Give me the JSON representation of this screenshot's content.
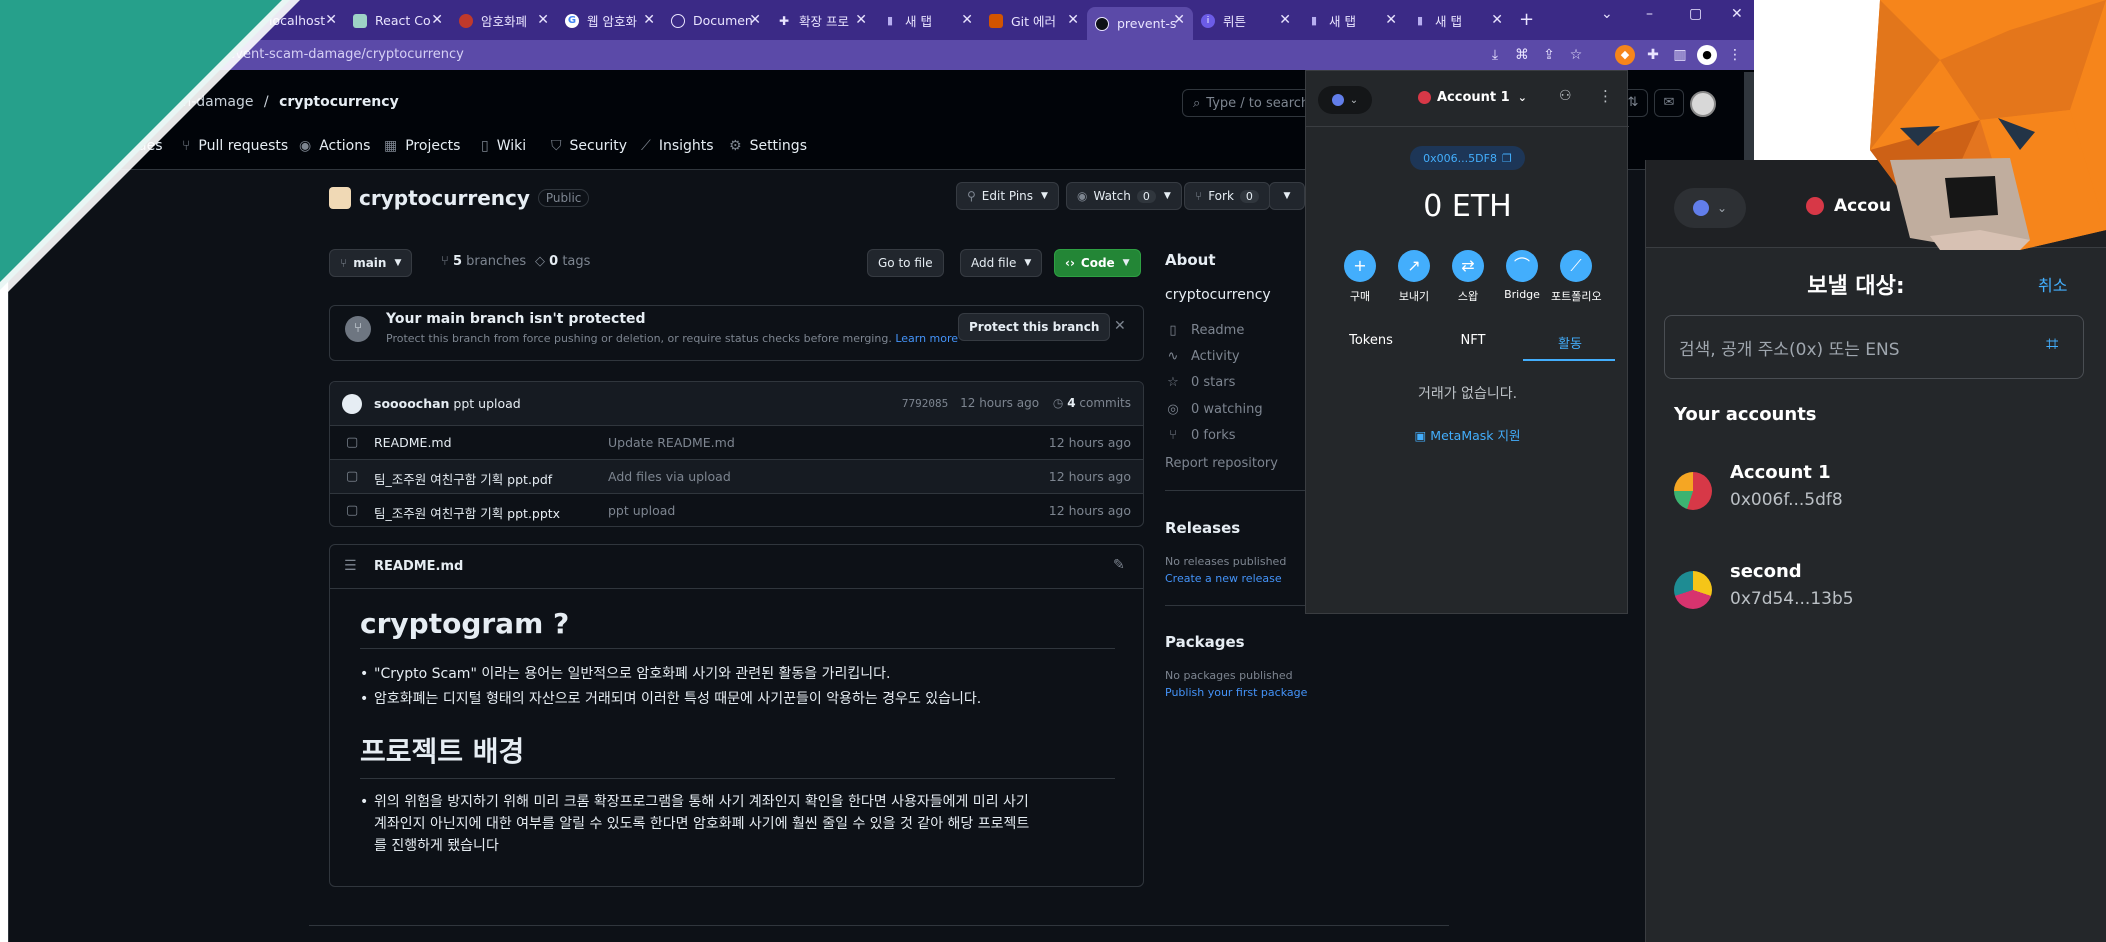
{
  "browser": {
    "tabs": [
      {
        "label": "localhost",
        "icon": "globe-icon",
        "active": false
      },
      {
        "label": "React Co",
        "icon": "react-icon",
        "active": false
      },
      {
        "label": "암호화폐",
        "icon": "coin-icon",
        "active": false
      },
      {
        "label": "웹 암호화",
        "icon": "google-icon",
        "active": false
      },
      {
        "label": "Documen",
        "icon": "globe-icon",
        "active": false
      },
      {
        "label": "확장 프로",
        "icon": "puzzle-icon",
        "active": false
      },
      {
        "label": "새 탭",
        "icon": "bookmark-icon",
        "active": false
      },
      {
        "label": "Git 에러",
        "icon": "velog-icon",
        "active": false
      },
      {
        "label": "prevent-s",
        "icon": "github-icon",
        "active": true
      },
      {
        "label": "뤼튼",
        "icon": "wrtn-icon",
        "active": false
      },
      {
        "label": "새 탭",
        "icon": "bookmark-icon",
        "active": false
      },
      {
        "label": "새 탭",
        "icon": "bookmark-icon",
        "active": false
      }
    ],
    "new_tab": "+",
    "url": "prevent-scam-damage/cryptocurrency"
  },
  "github": {
    "breadcrumb": {
      "owner": "scam-damage",
      "sep": "/",
      "repo": "cryptocurrency"
    },
    "search_placeholder": "Type / to search",
    "nav": [
      {
        "label": "Issues",
        "icon": "issue-icon"
      },
      {
        "label": "Pull requests",
        "icon": "pull-request-icon"
      },
      {
        "label": "Actions",
        "icon": "play-icon"
      },
      {
        "label": "Projects",
        "icon": "table-icon"
      },
      {
        "label": "Wiki",
        "icon": "book-icon"
      },
      {
        "label": "Security",
        "icon": "shield-icon"
      },
      {
        "label": "Insights",
        "icon": "graph-icon"
      },
      {
        "label": "Settings",
        "icon": "gear-icon"
      }
    ],
    "repo": {
      "title": "cryptocurrency",
      "visibility": "Public"
    },
    "buttons": {
      "edit_pins": "Edit Pins",
      "watch": "Watch",
      "watch_count": "0",
      "fork": "Fork",
      "fork_count": "0",
      "branch": "main",
      "go_to_file": "Go to file",
      "add_file": "Add file",
      "code": "Code"
    },
    "branches": {
      "count": "5",
      "label": "branches"
    },
    "tags": {
      "count": "0",
      "label": "tags"
    },
    "protect": {
      "title": "Your main branch isn't protected",
      "desc": "Protect this branch from force pushing or deletion, or require status checks before merging.",
      "learn_more": "Learn more",
      "button": "Protect this branch"
    },
    "commit": {
      "author": "soooochan",
      "message": "ppt upload",
      "hash": "7792085",
      "time": "12 hours ago",
      "count": "4",
      "count_label": "commits"
    },
    "files": [
      {
        "name": "README.md",
        "message": "Update README.md",
        "time": "12 hours ago"
      },
      {
        "name": "팀_조주원 여친구함 기획 ppt.pdf",
        "message": "Add files via upload",
        "time": "12 hours ago"
      },
      {
        "name": "팀_조주원 여친구함 기획 ppt.pptx",
        "message": "ppt upload",
        "time": "12 hours ago"
      }
    ],
    "readme": {
      "filename": "README.md",
      "h1": "cryptogram ?",
      "bullets1": [
        "\"Crypto Scam\" 이라는 용어는 일반적으로 암호화폐 사기와 관련된 활동을 가리킵니다.",
        "암호화폐는 디지털 형태의 자산으로 거래되며 이러한 특성 때문에 사기꾼들이 악용하는 경우도 있습니다."
      ],
      "h2": "프로젝트 배경",
      "bullet2_lines": [
        "위의 위험을 방지하기 위해 미리 크롬 확장프로그램을 통해 사기 계좌인지 확인을 한다면 사용자들에게 미리 사기",
        "계좌인지 아닌지에 대한 여부를 알릴 수 있도록 한다면 암호화폐 사기에 훨씬 줄일 수 있을 것 같아 해당 프로젝트",
        "를 진행하게 됐습니다"
      ]
    },
    "about": {
      "title": "About",
      "desc": "cryptocurrency",
      "items": [
        {
          "label": "Readme",
          "icon": "book-icon"
        },
        {
          "label": "Activity",
          "icon": "pulse-icon"
        },
        {
          "label": "0 stars",
          "icon": "star-icon"
        },
        {
          "label": "0 watching",
          "icon": "eye-icon"
        },
        {
          "label": "0 forks",
          "icon": "fork-icon"
        }
      ],
      "report": "Report repository"
    },
    "releases": {
      "title": "Releases",
      "empty": "No releases published",
      "link": "Create a new release"
    },
    "packages": {
      "title": "Packages",
      "empty": "No packages published",
      "link": "Publish your first package"
    }
  },
  "metamask_popup": {
    "account": "Account 1",
    "address": "0x006...5DF8",
    "balance": "0 ETH",
    "actions": [
      {
        "label": "구매",
        "icon": "plus-icon"
      },
      {
        "label": "보내기",
        "icon": "send-arrow-icon"
      },
      {
        "label": "스왑",
        "icon": "swap-icon"
      },
      {
        "label": "Bridge",
        "icon": "bridge-icon"
      },
      {
        "label": "포트폴리오",
        "icon": "chart-icon"
      }
    ],
    "tabs": [
      {
        "label": "Tokens",
        "active": false
      },
      {
        "label": "NFT",
        "active": false
      },
      {
        "label": "활동",
        "active": true
      }
    ],
    "empty": "거래가 없습니다.",
    "support": "MetaMask 지원"
  },
  "send_panel": {
    "account": "Accou",
    "title": "보낼 대상:",
    "cancel": "취소",
    "search_placeholder": "검색, 공개 주소(0x) 또는 ENS",
    "your_accounts": "Your accounts",
    "accounts": [
      {
        "name": "Account 1",
        "address": "0x006f...5df8"
      },
      {
        "name": "second",
        "address": "0x7d54...13b5"
      }
    ]
  },
  "colors": {
    "tabbar": "#3b2a86",
    "github_bg": "#0d1117",
    "green_button": "#238636",
    "metamask_blue": "#43aefc",
    "teal_corner": "#26a08b",
    "fox_orange": "#f6851b"
  }
}
